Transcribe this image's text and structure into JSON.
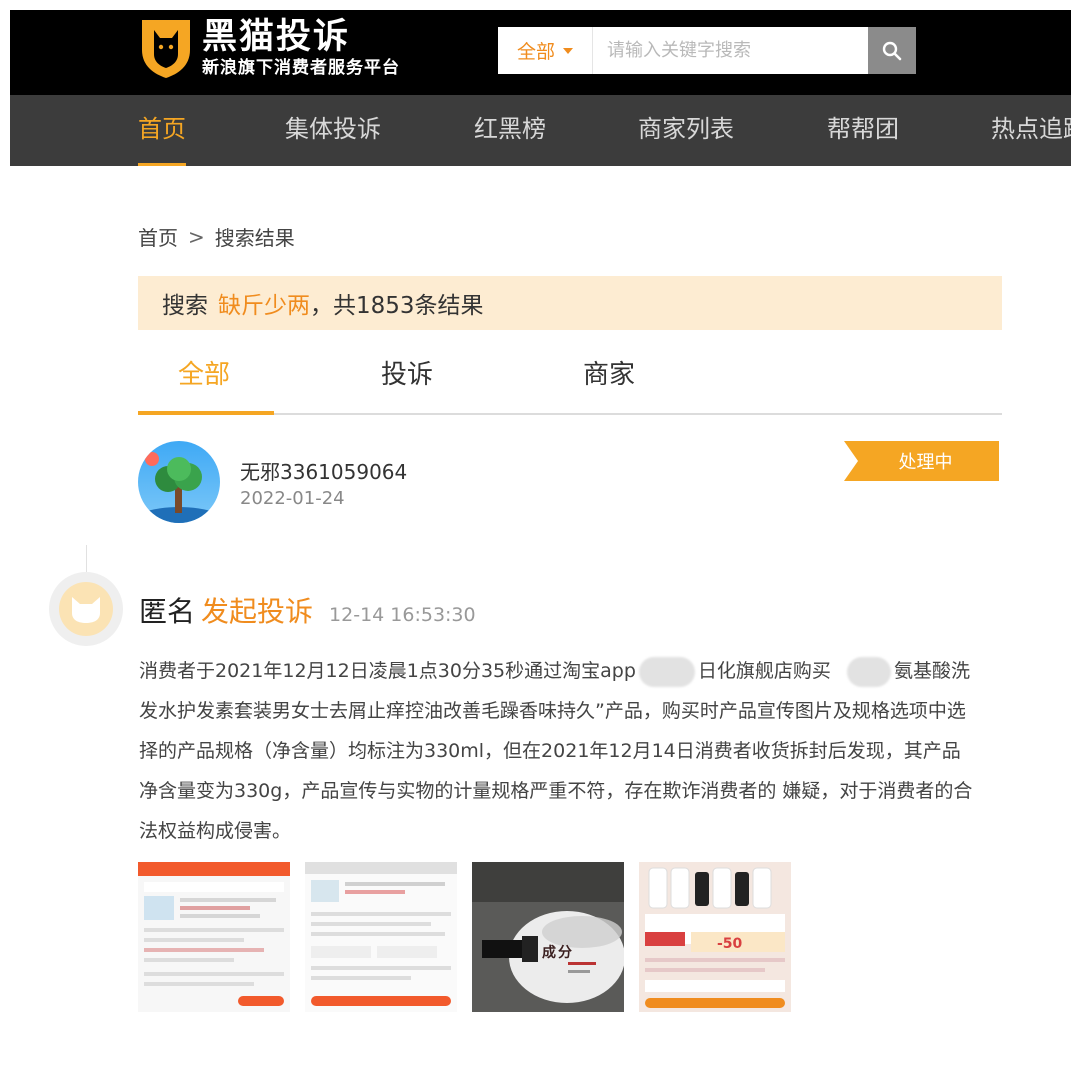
{
  "header": {
    "logo_title": "黑猫投诉",
    "logo_subtitle": "新浪旗下消费者服务平台",
    "search_scope": "全部",
    "search_placeholder": "请输入关键字搜索"
  },
  "nav": {
    "items": [
      {
        "label": "首页",
        "active": true
      },
      {
        "label": "集体投诉"
      },
      {
        "label": "红黑榜"
      },
      {
        "label": "商家列表"
      },
      {
        "label": "帮帮团"
      },
      {
        "label": "热点追踪"
      }
    ]
  },
  "breadcrumb": {
    "home": "首页",
    "separator": ">",
    "current": "搜索结果"
  },
  "result_summary": {
    "prefix": "搜索",
    "keyword": "缺斤少两",
    "suffix": "，共1853条结果"
  },
  "tabs": [
    {
      "label": "全部",
      "active": true
    },
    {
      "label": "投诉"
    },
    {
      "label": "商家"
    }
  ],
  "complaint": {
    "user_name": "无邪3361059064",
    "date": "2022-01-24",
    "status": "处理中",
    "event": {
      "who": "匿名",
      "action": "发起投诉",
      "time": "12-14 16:53:30",
      "text_part1": "消费者于2021年12月12日凌晨1点30分35秒通过淘宝app",
      "text_part2": "日化旗舰店购买",
      "text_part3": "氨基酸洗发水护发素套装男女士去屑止痒控油改善毛躁香味持久”产品，购买时产品宣传图片及规格选项中选择的产品规格（净含量）均标注为330ml，但在2021年12月14日消费者收货拆封后发现，其产品净含量变为330g，产品宣传与实物的计量规格严重不符，存在欺诈消费者的 嫌疑，对于消费者的合法权益构成侵害。"
    },
    "image_count": 4,
    "product_promo_text": "-50"
  },
  "colors": {
    "accent": "#f5a623",
    "link_orange": "#f08c1e",
    "header_bg": "#000000",
    "nav_bg": "#3c3c3c",
    "summary_bg": "#fdecd2"
  }
}
